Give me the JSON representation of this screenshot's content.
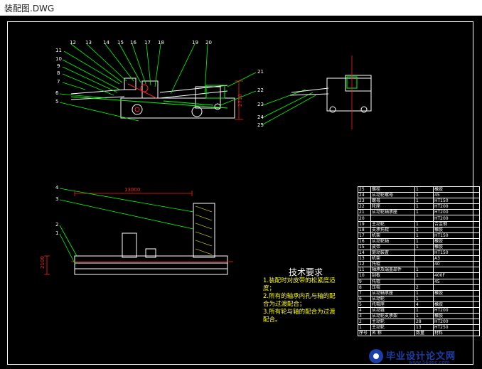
{
  "window": {
    "title": "装配图.DWG"
  },
  "drawing": {
    "top_view_labels": [
      "11",
      "12",
      "13",
      "14",
      "15",
      "16",
      "17",
      "18",
      "19",
      "20",
      "10",
      "9",
      "8",
      "7",
      "6",
      "5"
    ],
    "right_labels": [
      "21",
      "22",
      "23",
      "24",
      "25"
    ],
    "dimension_vertical": "2710",
    "bottom_labels": [
      "4",
      "3",
      "2",
      "1"
    ],
    "dimension_length": "13000",
    "dimension_height": "2100"
  },
  "tech_notes": {
    "heading": "技术要求",
    "lines": [
      "1.装配时对皮带的松紧度适",
      "度；",
      "2.所有的轴承内孔与轴的配",
      "合为过渡配合；",
      "3.所有轮与轴的配合为过渡",
      "配合。"
    ]
  },
  "bom_rows": [
    [
      "25",
      "螺栓",
      "1",
      "橡胶"
    ],
    [
      "24",
      "从动轮螺母",
      "1",
      "45"
    ],
    [
      "23",
      "螺母",
      "1",
      "HT150"
    ],
    [
      "22",
      "轮座",
      "1",
      "HT200"
    ],
    [
      "21",
      "从动轮轴承座",
      "1",
      "HT200"
    ],
    [
      "20",
      "",
      "",
      "HT200"
    ],
    [
      "19",
      "主动轮",
      "1",
      "合金钢"
    ],
    [
      "18",
      "支承托辊",
      "1",
      "橡胶"
    ],
    [
      "17",
      "机架",
      "1",
      "HT150"
    ],
    [
      "16",
      "从动轮轴",
      "1",
      "橡胶"
    ],
    [
      "15",
      "皮带",
      "1",
      "橡胶"
    ],
    [
      "14",
      "驱动装置",
      "",
      "HT150"
    ],
    [
      "13",
      "机架",
      "",
      "A3"
    ],
    [
      "12",
      "托辊",
      "",
      "40"
    ],
    [
      "11",
      "轴承及端盖部件",
      "1",
      ""
    ],
    [
      "10",
      "刮板",
      "1",
      "400F"
    ],
    [
      "9",
      "托辊",
      "",
      "45"
    ],
    [
      "8",
      "压辊",
      "2",
      ""
    ],
    [
      "7",
      "从动轴承座",
      "1",
      "橡胶"
    ],
    [
      "6",
      "从动轮",
      "1",
      ""
    ],
    [
      "5",
      "托辊座",
      "4",
      "橡胶"
    ],
    [
      "4",
      "从动链",
      "1",
      "HT200"
    ],
    [
      "3",
      "从动轮支承架",
      "1",
      "橡胶"
    ],
    [
      "2",
      "主动轮",
      "28",
      "HT200"
    ],
    [
      "1",
      "主动轮",
      "13",
      "HT250"
    ],
    [
      "序号",
      "名 称",
      "数量",
      "材料"
    ]
  ],
  "logo": {
    "brand": "毕业设计论文网",
    "url": "www.56doc.com"
  }
}
